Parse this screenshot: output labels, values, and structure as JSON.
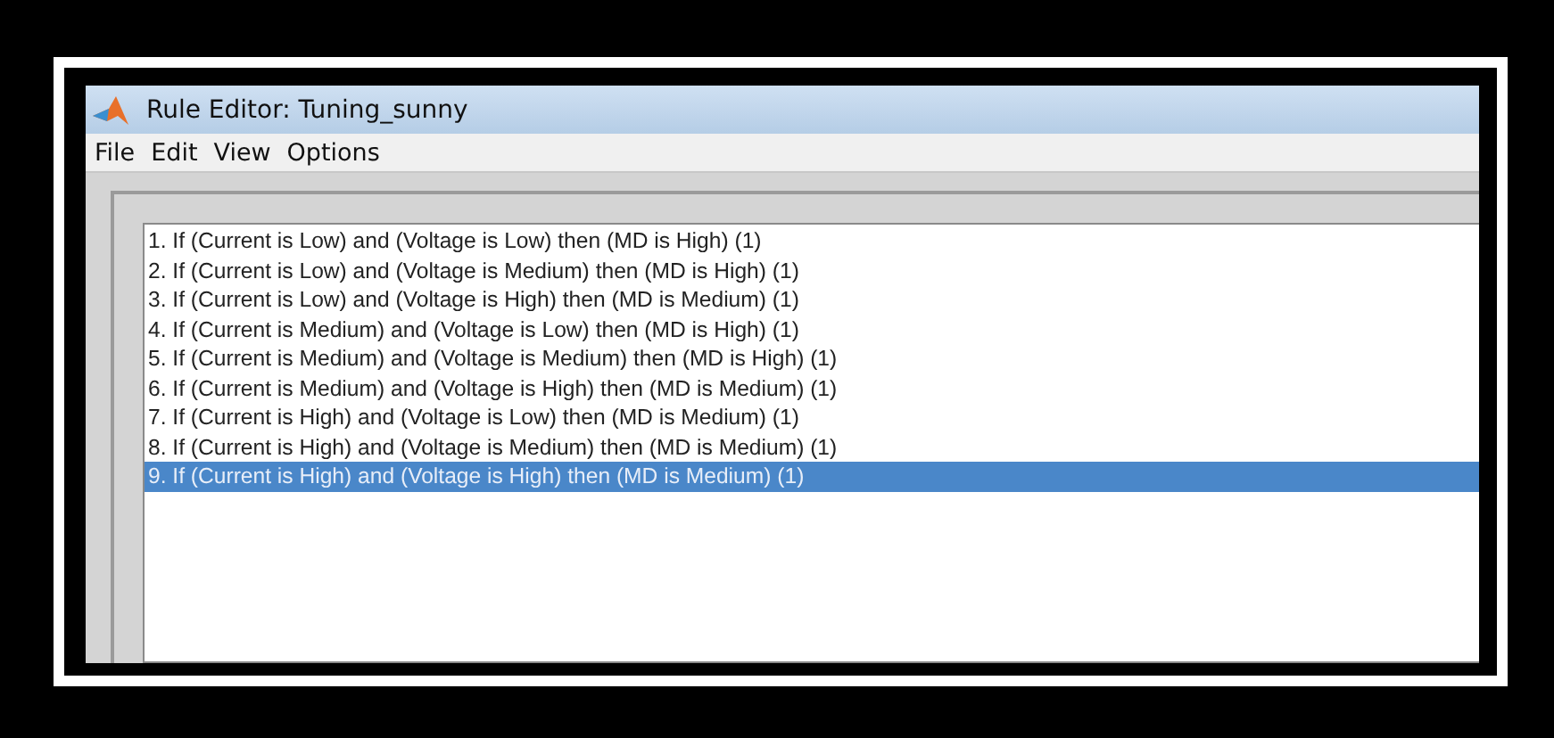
{
  "window": {
    "title": "Rule Editor: Tuning_sunny"
  },
  "menu": [
    "File",
    "Edit",
    "View",
    "Options"
  ],
  "rules": [
    {
      "text": "1. If (Current is Low) and (Voltage is Low) then (MD is High) (1)",
      "selected": false
    },
    {
      "text": "2. If (Current is Low) and (Voltage is Medium) then (MD is High) (1)",
      "selected": false
    },
    {
      "text": "3. If (Current is Low) and (Voltage is High) then (MD is Medium) (1)",
      "selected": false
    },
    {
      "text": "4. If (Current is Medium) and (Voltage is Low) then (MD is High) (1)",
      "selected": false
    },
    {
      "text": "5. If (Current is Medium) and (Voltage is Medium) then (MD is High) (1)",
      "selected": false
    },
    {
      "text": "6. If (Current is Medium) and (Voltage is High) then (MD is Medium) (1)",
      "selected": false
    },
    {
      "text": "7. If (Current is High) and (Voltage is Low) then (MD is Medium) (1)",
      "selected": false
    },
    {
      "text": "8. If (Current is High) and (Voltage is Medium) then (MD is Medium) (1)",
      "selected": false
    },
    {
      "text": "9. If (Current is High) and (Voltage is High) then (MD is Medium) (1)",
      "selected": true
    }
  ]
}
